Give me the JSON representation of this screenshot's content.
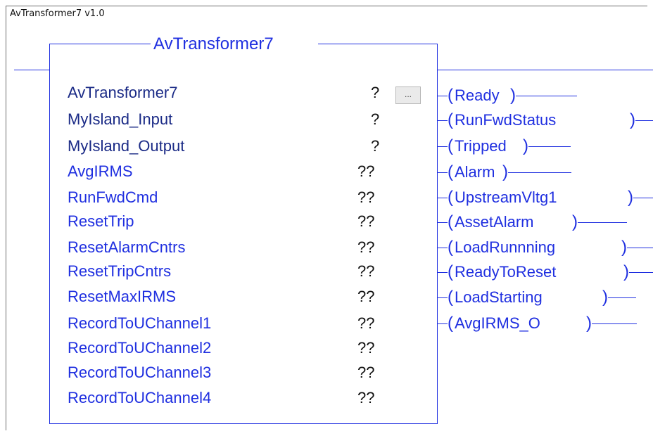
{
  "window": {
    "caption": "AvTransformer7 v1.0"
  },
  "block": {
    "title": "AvTransformer7",
    "ellipsis_label": "...",
    "params": [
      {
        "name": "AvTransformer7",
        "value": "?"
      },
      {
        "name": "MyIsland_Input",
        "value": "?"
      },
      {
        "name": "MyIsland_Output",
        "value": "?"
      },
      {
        "name": "AvgIRMS",
        "value": "??"
      },
      {
        "name": "RunFwdCmd",
        "value": "??"
      },
      {
        "name": "ResetTrip",
        "value": "??"
      },
      {
        "name": "ResetAlarmCntrs",
        "value": "??"
      },
      {
        "name": "ResetTripCntrs",
        "value": "??"
      },
      {
        "name": "ResetMaxIRMS",
        "value": "??"
      },
      {
        "name": "RecordToUChannel1",
        "value": "??"
      },
      {
        "name": "RecordToUChannel2",
        "value": "??"
      },
      {
        "name": "RecordToUChannel3",
        "value": "??"
      },
      {
        "name": "RecordToUChannel4",
        "value": "??"
      }
    ]
  },
  "coils": {
    "open": "(",
    "close": ")",
    "items": [
      "Ready",
      "RunFwdStatus",
      "Tripped",
      "Alarm",
      "UpstreamVltg1",
      "AssetAlarm",
      "LoadRunnning",
      "ReadyToReset",
      "LoadStarting",
      "AvgIRMS_O"
    ]
  }
}
